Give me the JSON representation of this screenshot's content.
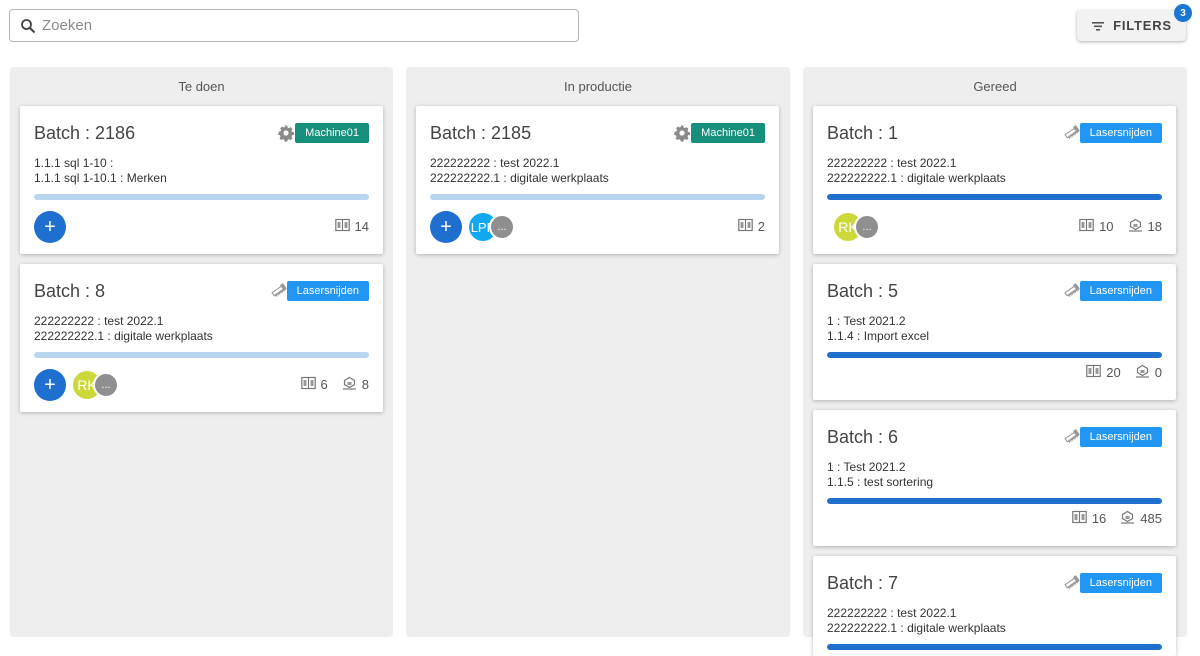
{
  "search": {
    "placeholder": "Zoeken"
  },
  "filters": {
    "label": "FILTERS",
    "count": "3"
  },
  "colors": {
    "machine_tag": "#16907d",
    "laser_tag": "#2196f3",
    "progress_fill": "#1f6fcc",
    "progress_track": "#b9d4ee",
    "add_avatar": "#1e6fcf",
    "rk_avatar": "#cdd93b",
    "lpp_avatar": "#10a9f1",
    "more_avatar": "#8f8f8f"
  },
  "columns": [
    {
      "title": "Te doen",
      "cards": [
        {
          "title": "Batch : 2186",
          "icon": "gear-icon",
          "tag": "Machine01",
          "tag_type": "machine",
          "lines": [
            "1.1.1 sql 1-10 :",
            "1.1.1 sql 1-10.1 : Merken"
          ],
          "progress": 0,
          "avatars": [
            "add"
          ],
          "stats": [
            {
              "icon": "sheets-icon",
              "value": "14"
            }
          ]
        },
        {
          "title": "Batch : 8",
          "icon": "saw-icon",
          "tag": "Lasersnijden",
          "tag_type": "laser",
          "lines": [
            "222222222 : test 2022.1",
            "222222222.1 : digitale werkplaats"
          ],
          "progress": 0,
          "avatars": [
            "add",
            "RK",
            "..."
          ],
          "stats": [
            {
              "icon": "sheets-icon",
              "value": "6"
            },
            {
              "icon": "parts-icon",
              "value": "8"
            }
          ]
        }
      ]
    },
    {
      "title": "In productie",
      "cards": [
        {
          "title": "Batch : 2185",
          "icon": "gear-icon",
          "tag": "Machine01",
          "tag_type": "machine",
          "lines": [
            "222222222 : test 2022.1",
            "222222222.1 : digitale werkplaats"
          ],
          "progress": 0,
          "avatars": [
            "add",
            "LPP",
            "..."
          ],
          "stats": [
            {
              "icon": "sheets-icon",
              "value": "2"
            }
          ]
        }
      ]
    },
    {
      "title": "Gereed",
      "cards": [
        {
          "title": "Batch : 1",
          "icon": "saw-icon",
          "tag": "Lasersnijden",
          "tag_type": "laser",
          "lines": [
            "222222222 : test 2022.1",
            "222222222.1 : digitale werkplaats"
          ],
          "progress": 1,
          "avatars": [
            "RK",
            "..."
          ],
          "stats": [
            {
              "icon": "sheets-icon",
              "value": "10"
            },
            {
              "icon": "parts-icon",
              "value": "18"
            }
          ]
        },
        {
          "title": "Batch : 5",
          "icon": "saw-icon",
          "tag": "Lasersnijden",
          "tag_type": "laser",
          "lines": [
            "1 : Test 2021.2",
            "1.1.4 : Import excel"
          ],
          "progress": 1,
          "avatars": [],
          "stats": [
            {
              "icon": "sheets-icon",
              "value": "20"
            },
            {
              "icon": "parts-icon",
              "value": "0"
            }
          ]
        },
        {
          "title": "Batch : 6",
          "icon": "saw-icon",
          "tag": "Lasersnijden",
          "tag_type": "laser",
          "lines": [
            "1 : Test 2021.2",
            "1.1.5 : test sortering"
          ],
          "progress": 1,
          "avatars": [],
          "stats": [
            {
              "icon": "sheets-icon",
              "value": "16"
            },
            {
              "icon": "parts-icon",
              "value": "485"
            }
          ]
        },
        {
          "title": "Batch : 7",
          "icon": "saw-icon",
          "tag": "Lasersnijden",
          "tag_type": "laser",
          "lines": [
            "222222222 : test 2022.1",
            "222222222.1 : digitale werkplaats"
          ],
          "progress": 1,
          "avatars": [],
          "stats": []
        }
      ]
    }
  ]
}
